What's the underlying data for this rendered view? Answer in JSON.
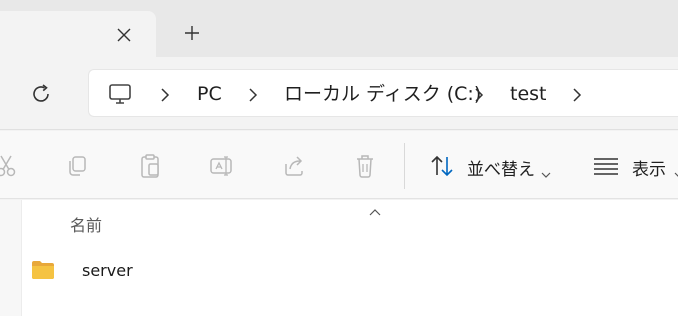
{
  "tabstrip": {
    "close_icon": "close-icon",
    "new_tab_icon": "plus-icon"
  },
  "address": {
    "refresh_icon": "refresh-icon",
    "breadcrumbs": [
      "PC",
      "ローカル ディスク (C:)",
      "test"
    ],
    "root_icon": "monitor-icon"
  },
  "toolbar": {
    "sort_label": "並べ替え",
    "view_label": "表示",
    "buttons": [
      "cut-icon",
      "copy-icon",
      "paste-icon",
      "rename-icon",
      "share-icon",
      "delete-icon"
    ]
  },
  "filelist": {
    "column_header": "名前",
    "items": [
      {
        "name": "server",
        "icon": "folder-icon"
      }
    ]
  },
  "colors": {
    "folder": "#f5c342",
    "disabled_icon": "#b8b8b8",
    "accent": "#0067c0"
  }
}
